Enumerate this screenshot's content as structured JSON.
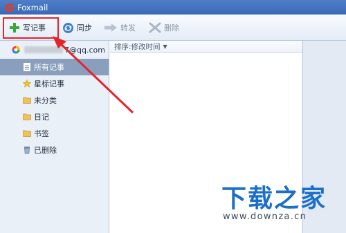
{
  "window": {
    "title": "Foxmail",
    "logo_icon": "foxmail-logo-icon"
  },
  "toolbar": {
    "write_label": "写记事",
    "sync_label": "同步",
    "forward_label": "转发",
    "delete_label": "删除"
  },
  "sidebar": {
    "account_email": "7@qq.com",
    "items": [
      {
        "label": "所有记事",
        "icon": "note-icon",
        "active": true
      },
      {
        "label": "星标记事",
        "icon": "star-icon"
      },
      {
        "label": "未分类",
        "icon": "folder-icon"
      },
      {
        "label": "日记",
        "icon": "folder-icon"
      },
      {
        "label": "书签",
        "icon": "folder-icon"
      },
      {
        "label": "已删除",
        "icon": "trash-icon"
      }
    ]
  },
  "list": {
    "sort_label": "排序:修改时间"
  },
  "watermark": {
    "title": "下载之家",
    "url": "www.downza.cn"
  },
  "colors": {
    "titlebar": "#3a6ab7",
    "highlight": "#e5232b",
    "active_item": "#8a9fbd"
  }
}
